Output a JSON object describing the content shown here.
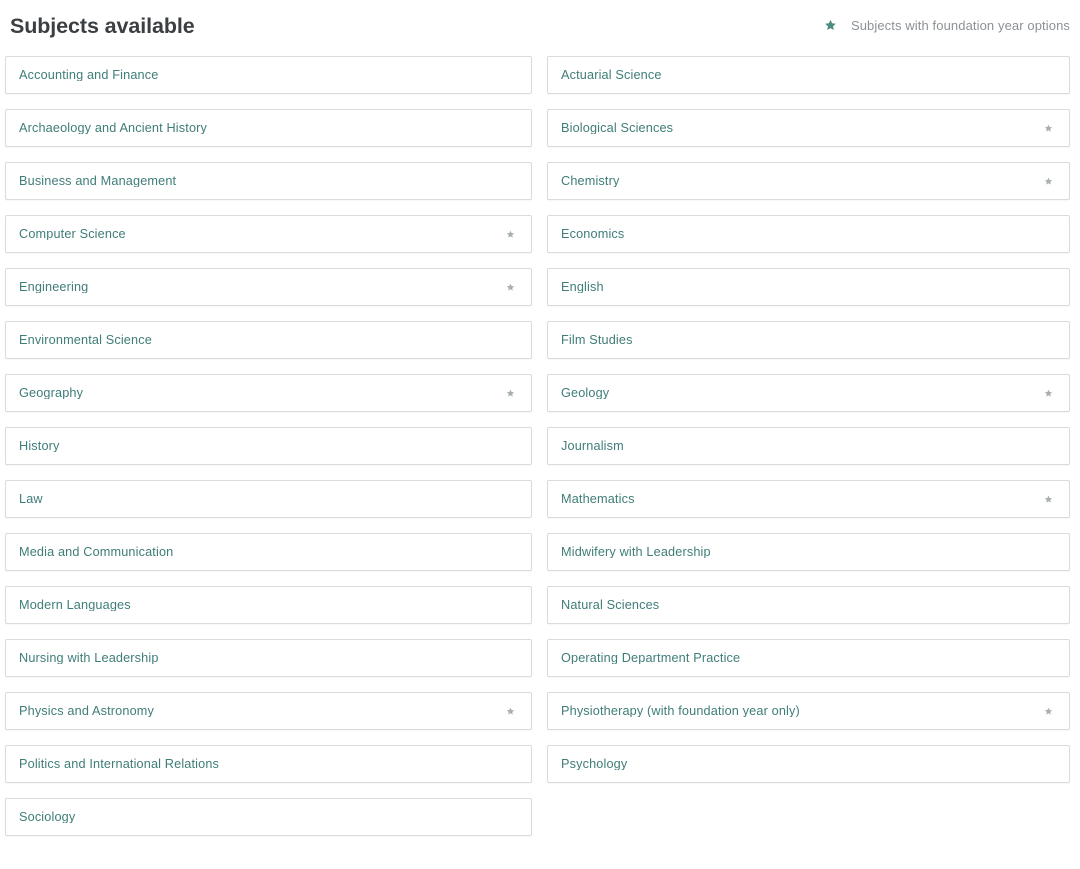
{
  "header": {
    "title": "Subjects available",
    "legend": {
      "icon": "star-icon",
      "label": "Subjects with foundation year options"
    }
  },
  "colors": {
    "title_text": "#3b3f42",
    "subject_text": "#3f7d78",
    "card_border": "#d8dcde",
    "card_background": "#ffffff",
    "legend_star": "#4c8b7f",
    "legend_text": "#8b9296",
    "card_star": "#9aa2a6",
    "page_background": "#ffffff"
  },
  "subjects": {
    "left_column": [
      {
        "name": "Accounting and Finance",
        "foundation_year": false
      },
      {
        "name": "Archaeology and Ancient History",
        "foundation_year": false
      },
      {
        "name": "Business and Management",
        "foundation_year": false
      },
      {
        "name": "Computer Science",
        "foundation_year": true
      },
      {
        "name": "Engineering",
        "foundation_year": true
      },
      {
        "name": "Environmental Science",
        "foundation_year": false
      },
      {
        "name": "Geography",
        "foundation_year": true
      },
      {
        "name": "History",
        "foundation_year": false
      },
      {
        "name": "Law",
        "foundation_year": false
      },
      {
        "name": "Media and Communication",
        "foundation_year": false
      },
      {
        "name": "Modern Languages",
        "foundation_year": false
      },
      {
        "name": "Nursing with Leadership",
        "foundation_year": false
      },
      {
        "name": "Physics and Astronomy",
        "foundation_year": true
      },
      {
        "name": "Politics and International Relations",
        "foundation_year": false
      },
      {
        "name": "Sociology",
        "foundation_year": false
      }
    ],
    "right_column": [
      {
        "name": "Actuarial Science",
        "foundation_year": false
      },
      {
        "name": "Biological Sciences",
        "foundation_year": true
      },
      {
        "name": "Chemistry",
        "foundation_year": true
      },
      {
        "name": "Economics",
        "foundation_year": false
      },
      {
        "name": "English",
        "foundation_year": false
      },
      {
        "name": "Film Studies",
        "foundation_year": false
      },
      {
        "name": "Geology",
        "foundation_year": true
      },
      {
        "name": "Journalism",
        "foundation_year": false
      },
      {
        "name": "Mathematics",
        "foundation_year": true
      },
      {
        "name": "Midwifery with Leadership",
        "foundation_year": false
      },
      {
        "name": "Natural Sciences",
        "foundation_year": false
      },
      {
        "name": "Operating Department Practice",
        "foundation_year": false
      },
      {
        "name": "Physiotherapy (with foundation year only)",
        "foundation_year": true
      },
      {
        "name": "Psychology",
        "foundation_year": false
      }
    ]
  }
}
